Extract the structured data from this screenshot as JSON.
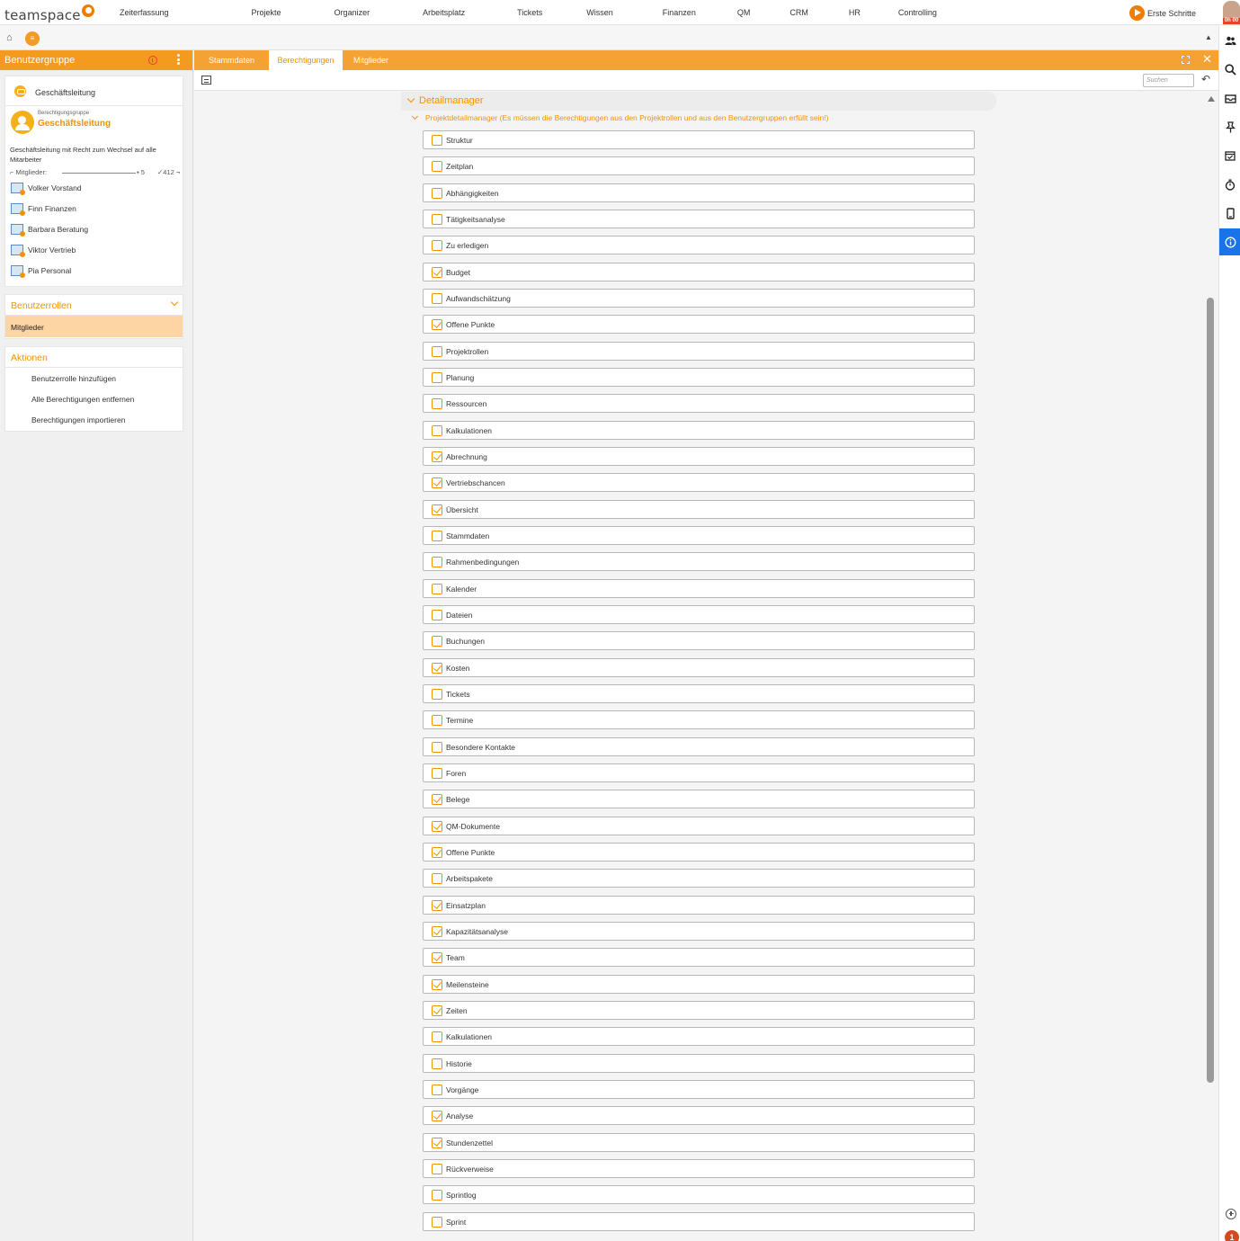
{
  "app": {
    "logo_text": "teamspace",
    "menu": [
      "Zeiterfassung",
      "Projekte",
      "Organizer",
      "Arbeitsplatz",
      "Tickets",
      "Wissen",
      "Finanzen",
      "QM",
      "CRM",
      "HR",
      "Controlling"
    ],
    "erste_schritte": "Erste Schritte",
    "timer_badge": "0h 00",
    "accent": "#f39200",
    "rail_active_color": "#1a73e8"
  },
  "subbar": {
    "home_icon": "home-icon",
    "dot_label": "≡"
  },
  "left": {
    "header": "Benutzergruppe",
    "card": {
      "top_title": "Geschäftsleitung",
      "group_small": "Berechtigungsgruppe",
      "group_title": "Geschäftsleitung",
      "description": "Geschäftsleitung mit Recht zum Wechsel auf alle Mitarbeiter",
      "members_label": "Mitglieder:",
      "count_a": "5",
      "count_b": "412",
      "members": [
        "Volker Vorstand",
        "Finn Finanzen",
        "Barbara Beratung",
        "Viktor Vertrieb",
        "Pia Personal"
      ]
    },
    "rollen": {
      "title": "Benutzerrollen",
      "selected": "Mitglieder"
    },
    "aktionen": {
      "title": "Aktionen",
      "items": [
        "Benutzerrolle hinzufügen",
        "Alle Berechtigungen entfernen",
        "Berechtigungen importieren"
      ]
    }
  },
  "main": {
    "tabs": [
      "Stammdaten",
      "Berechtigungen",
      "Mitglieder"
    ],
    "active_tab": "Berechtigungen",
    "search_placeholder": "Suchen",
    "section_title": "Detailmanager",
    "subsection_title": "Projektdetailmanager (Es müssen die Berechtigungen aus den Projektrollen und aus den Benutzergruppen erfüllt sein!)",
    "permissions": [
      {
        "label": "Struktur",
        "checked": false
      },
      {
        "label": "Zeitplan",
        "checked": false
      },
      {
        "label": "Abhängigkeiten",
        "checked": false
      },
      {
        "label": "Tätigkeitsanalyse",
        "checked": false
      },
      {
        "label": "Zu erledigen",
        "checked": false
      },
      {
        "label": "Budget",
        "checked": true
      },
      {
        "label": "Aufwandschätzung",
        "checked": false
      },
      {
        "label": "Offene Punkte",
        "checked": true
      },
      {
        "label": "Projektrollen",
        "checked": false
      },
      {
        "label": "Planung",
        "checked": false
      },
      {
        "label": "Ressourcen",
        "checked": false
      },
      {
        "label": "Kalkulationen",
        "checked": false
      },
      {
        "label": "Abrechnung",
        "checked": true
      },
      {
        "label": "Vertriebschancen",
        "checked": true
      },
      {
        "label": "Übersicht",
        "checked": true
      },
      {
        "label": "Stammdaten",
        "checked": false
      },
      {
        "label": "Rahmenbedingungen",
        "checked": false
      },
      {
        "label": "Kalender",
        "checked": false
      },
      {
        "label": "Dateien",
        "checked": false
      },
      {
        "label": "Buchungen",
        "checked": false
      },
      {
        "label": "Kosten",
        "checked": true
      },
      {
        "label": "Tickets",
        "checked": false
      },
      {
        "label": "Termine",
        "checked": false
      },
      {
        "label": "Besondere Kontakte",
        "checked": false
      },
      {
        "label": "Foren",
        "checked": false
      },
      {
        "label": "Belege",
        "checked": true
      },
      {
        "label": "QM-Dokumente",
        "checked": true
      },
      {
        "label": "Offene Punkte",
        "checked": true
      },
      {
        "label": "Arbeitspakete",
        "checked": false
      },
      {
        "label": "Einsatzplan",
        "checked": true
      },
      {
        "label": "Kapazitätsanalyse",
        "checked": true
      },
      {
        "label": "Team",
        "checked": true
      },
      {
        "label": "Meilensteine",
        "checked": true
      },
      {
        "label": "Zeiten",
        "checked": true
      },
      {
        "label": "Kalkulationen",
        "checked": false
      },
      {
        "label": "Historie",
        "checked": false
      },
      {
        "label": "Vorgänge",
        "checked": false
      },
      {
        "label": "Analyse",
        "checked": true
      },
      {
        "label": "Stundenzettel",
        "checked": true
      },
      {
        "label": "Rückverweise",
        "checked": false
      },
      {
        "label": "Sprintlog",
        "checked": false
      },
      {
        "label": "Sprint",
        "checked": false
      }
    ]
  },
  "rail": {
    "icons": [
      "users-icon",
      "search-icon",
      "inbox-icon",
      "pin-icon",
      "calendar-check-icon",
      "stopwatch-icon",
      "mobile-icon",
      "info-icon"
    ],
    "active_index": 7,
    "bottom_badge": "1"
  }
}
